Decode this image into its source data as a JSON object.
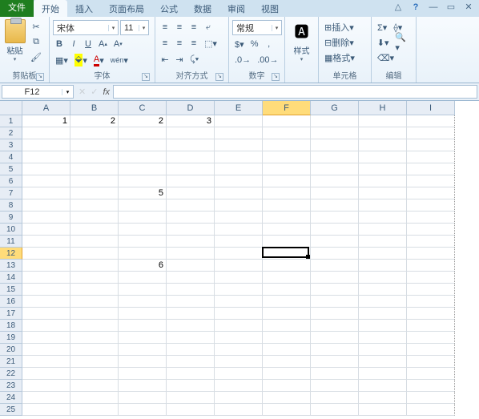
{
  "tabs": {
    "file": "文件",
    "items": [
      "开始",
      "插入",
      "页面布局",
      "公式",
      "数据",
      "审阅",
      "视图"
    ],
    "active": 0
  },
  "win": {
    "help": "?",
    "up": "△",
    "min": "—",
    "restore": "▭",
    "close": "✕"
  },
  "ribbon": {
    "clipboard": {
      "paste": "粘贴",
      "label": "剪贴板"
    },
    "font": {
      "name": "宋体",
      "size": "11",
      "bold": "B",
      "italic": "I",
      "underline": "U",
      "label": "字体"
    },
    "align": {
      "label": "对齐方式"
    },
    "number": {
      "format": "常规",
      "label": "数字"
    },
    "styles": {
      "btn": "样式"
    },
    "cells": {
      "insert": "插入",
      "delete": "删除",
      "format": "格式",
      "label": "单元格"
    },
    "editing": {
      "label": "编辑"
    }
  },
  "formula_bar": {
    "name": "F12",
    "fx": "fx"
  },
  "columns": [
    "A",
    "B",
    "C",
    "D",
    "E",
    "F",
    "G",
    "H",
    "I"
  ],
  "row_count": 25,
  "selected": {
    "col": 5,
    "row": 12
  },
  "cell_values": {
    "A1": "1",
    "B1": "2",
    "C1": "2",
    "D1": "3",
    "C7": "5",
    "C13": "6"
  }
}
